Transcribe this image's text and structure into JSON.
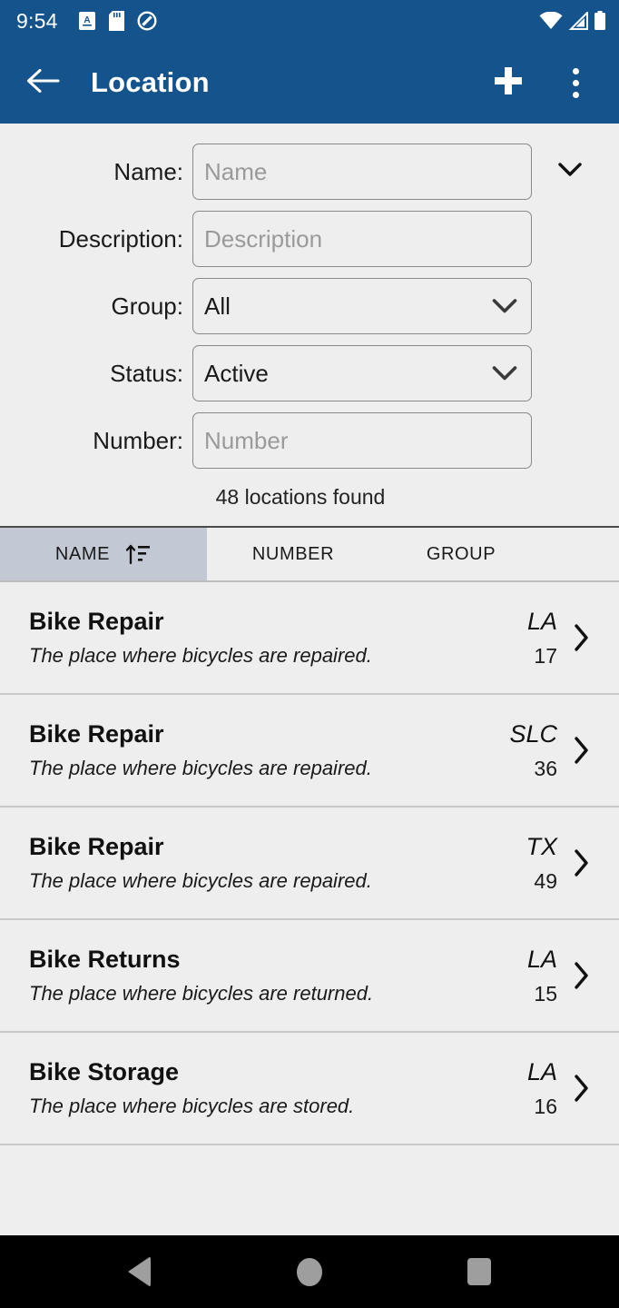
{
  "status_bar": {
    "time": "9:54",
    "left_icons": [
      "screenshot-icon",
      "sd-card-icon",
      "do-not-disturb-icon"
    ],
    "right_icons": [
      "wifi-icon",
      "cellular-signal-icon",
      "battery-icon"
    ]
  },
  "app_bar": {
    "title": "Location",
    "back_icon": "arrow-left-icon",
    "add_icon": "plus-icon",
    "overflow_icon": "more-vertical-icon",
    "background_color": "#15538C",
    "text_color": "#FFFFFF"
  },
  "search_form": {
    "fields": [
      {
        "label": "Name:",
        "type": "text",
        "value": "",
        "placeholder": "Name",
        "trailing_icon": "chevron-down-icon"
      },
      {
        "label": "Description:",
        "type": "text",
        "value": "",
        "placeholder": "Description"
      },
      {
        "label": "Group:",
        "type": "select",
        "value": "All",
        "placeholder": ""
      },
      {
        "label": "Status:",
        "type": "select",
        "value": "Active",
        "placeholder": ""
      },
      {
        "label": "Number:",
        "type": "text",
        "value": "",
        "placeholder": "Number"
      }
    ],
    "results_count": "48 locations found"
  },
  "table": {
    "columns": [
      {
        "label": "NAME",
        "sorted": true,
        "sort_icon": "sort-ascending-icon",
        "highlight_color": "#C3C9D4"
      },
      {
        "label": "NUMBER",
        "sorted": false
      },
      {
        "label": "GROUP",
        "sorted": false
      }
    ],
    "rows": [
      {
        "name": "Bike Repair",
        "description": "The place where bicycles are repaired.",
        "group": "LA",
        "number": "17",
        "chevron": "chevron-right-icon"
      },
      {
        "name": "Bike Repair",
        "description": "The place where bicycles are repaired.",
        "group": "SLC",
        "number": "36",
        "chevron": "chevron-right-icon"
      },
      {
        "name": "Bike Repair",
        "description": "The place where bicycles are repaired.",
        "group": "TX",
        "number": "49",
        "chevron": "chevron-right-icon"
      },
      {
        "name": "Bike Returns",
        "description": "The place where bicycles are returned.",
        "group": "LA",
        "number": "15",
        "chevron": "chevron-right-icon"
      },
      {
        "name": "Bike Storage",
        "description": "The place where bicycles are stored.",
        "group": "LA",
        "number": "16",
        "chevron": "chevron-right-icon"
      }
    ]
  },
  "nav_bar": {
    "back": "triangle-back-icon",
    "home": "circle-home-icon",
    "recents": "square-recents-icon"
  }
}
